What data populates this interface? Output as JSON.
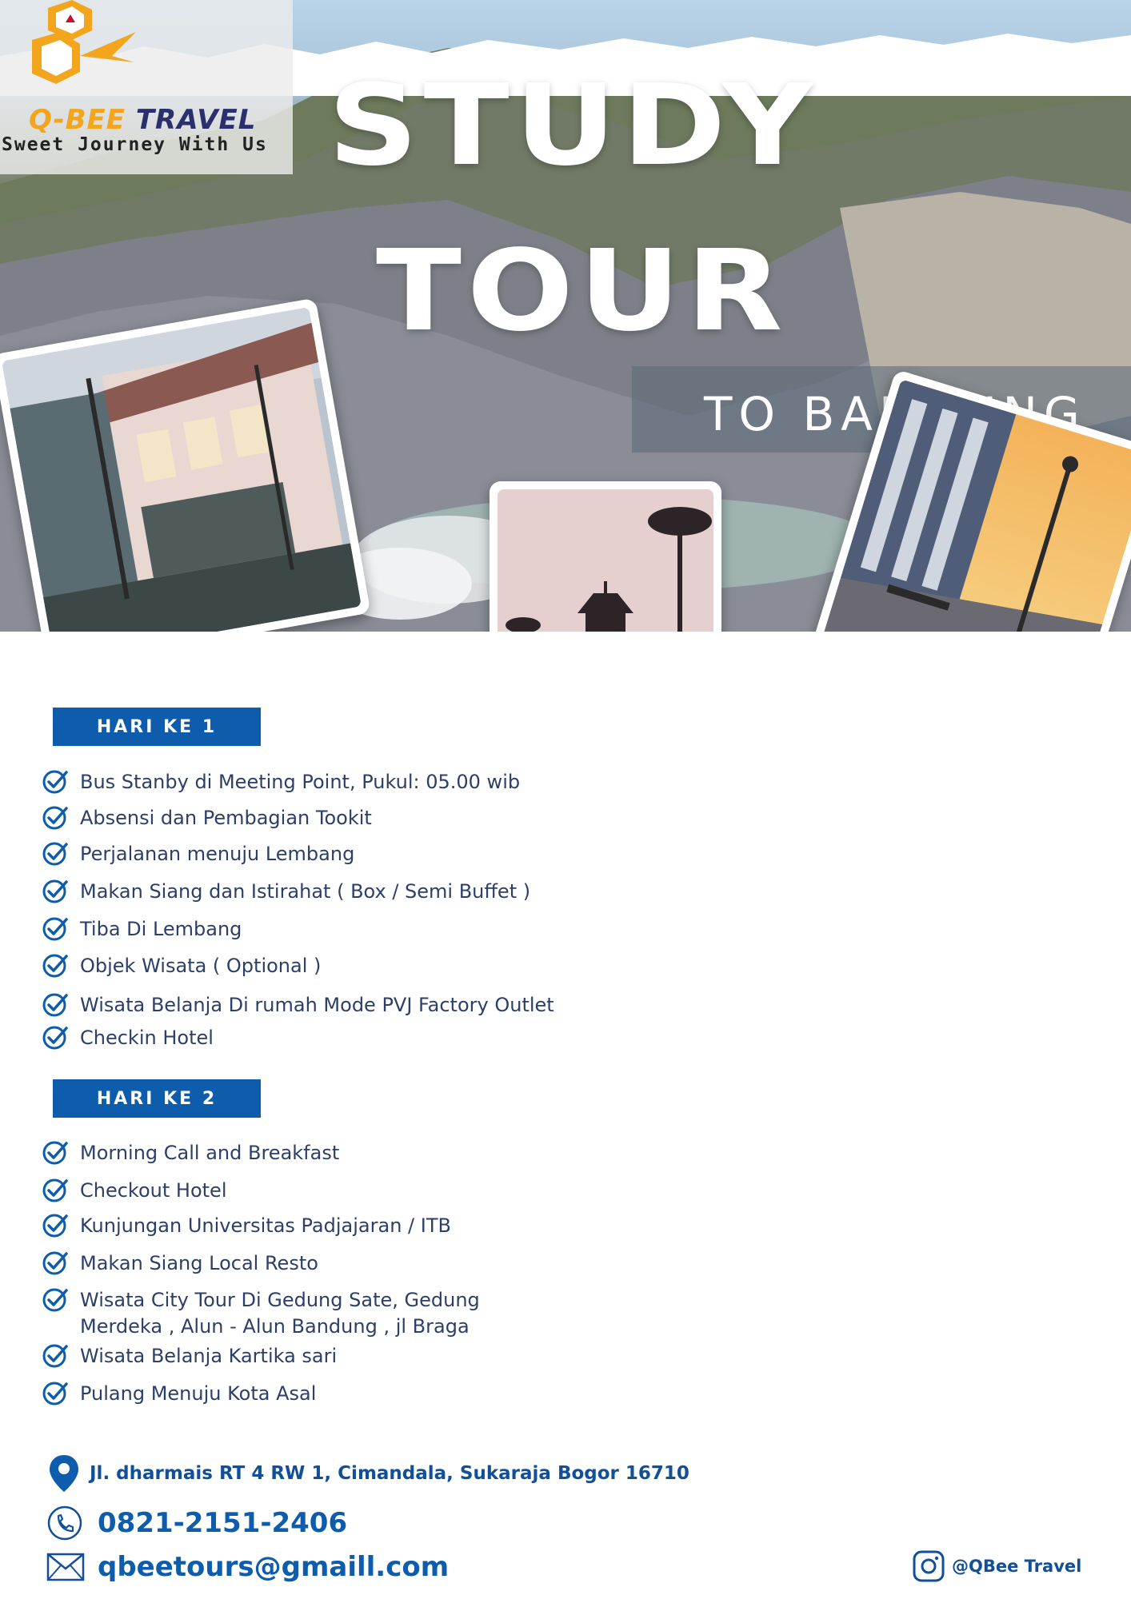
{
  "brand": {
    "name_part1": "Q-BEE",
    "name_part2": " TRAVEL",
    "tagline": "Sweet Journey With Us"
  },
  "hero": {
    "title_line1": "STUDY",
    "title_line2": "TOUR",
    "destination": "TO BANDUNG"
  },
  "itinerary": {
    "day1": {
      "label": "HARI KE 1",
      "items": [
        "Bus Stanby di Meeting Point, Pukul: 05.00 wib",
        "Absensi dan Pembagian Tookit",
        "Perjalanan menuju Lembang",
        "Makan Siang dan Istirahat ( Box / Semi Buffet )",
        "Tiba Di Lembang",
        "Objek Wisata ( Optional )",
        "Wisata Belanja Di rumah Mode PVJ Factory Outlet",
        "Checkin Hotel"
      ]
    },
    "day2": {
      "label": "HARI KE 2",
      "items": [
        "Morning Call and Breakfast",
        "Checkout Hotel",
        "Kunjungan Universitas Padjajaran / ITB",
        "Makan Siang Local Resto",
        "Wisata City Tour Di Gedung Sate, Gedung",
        "Merdeka , Alun - Alun Bandung , jl Braga",
        "Wisata Belanja Kartika sari",
        "Pulang Menuju Kota Asal"
      ]
    }
  },
  "contact": {
    "address": "Jl. dharmais RT 4 RW 1, Cimandala, Sukaraja Bogor 16710",
    "phone": "0821-2151-2406",
    "email": "qbeetours@gmaill.com",
    "instagram": "@QBee Travel"
  },
  "icons": {
    "check": "check-circle-icon",
    "location": "location-pin-icon",
    "phone": "phone-icon",
    "email": "envelope-icon",
    "instagram": "instagram-icon"
  },
  "colors": {
    "accent_blue": "#0e5cac",
    "text_navy": "#2c3f68",
    "brand_orange": "#f2a51d",
    "brand_navy": "#2b2f6e"
  }
}
